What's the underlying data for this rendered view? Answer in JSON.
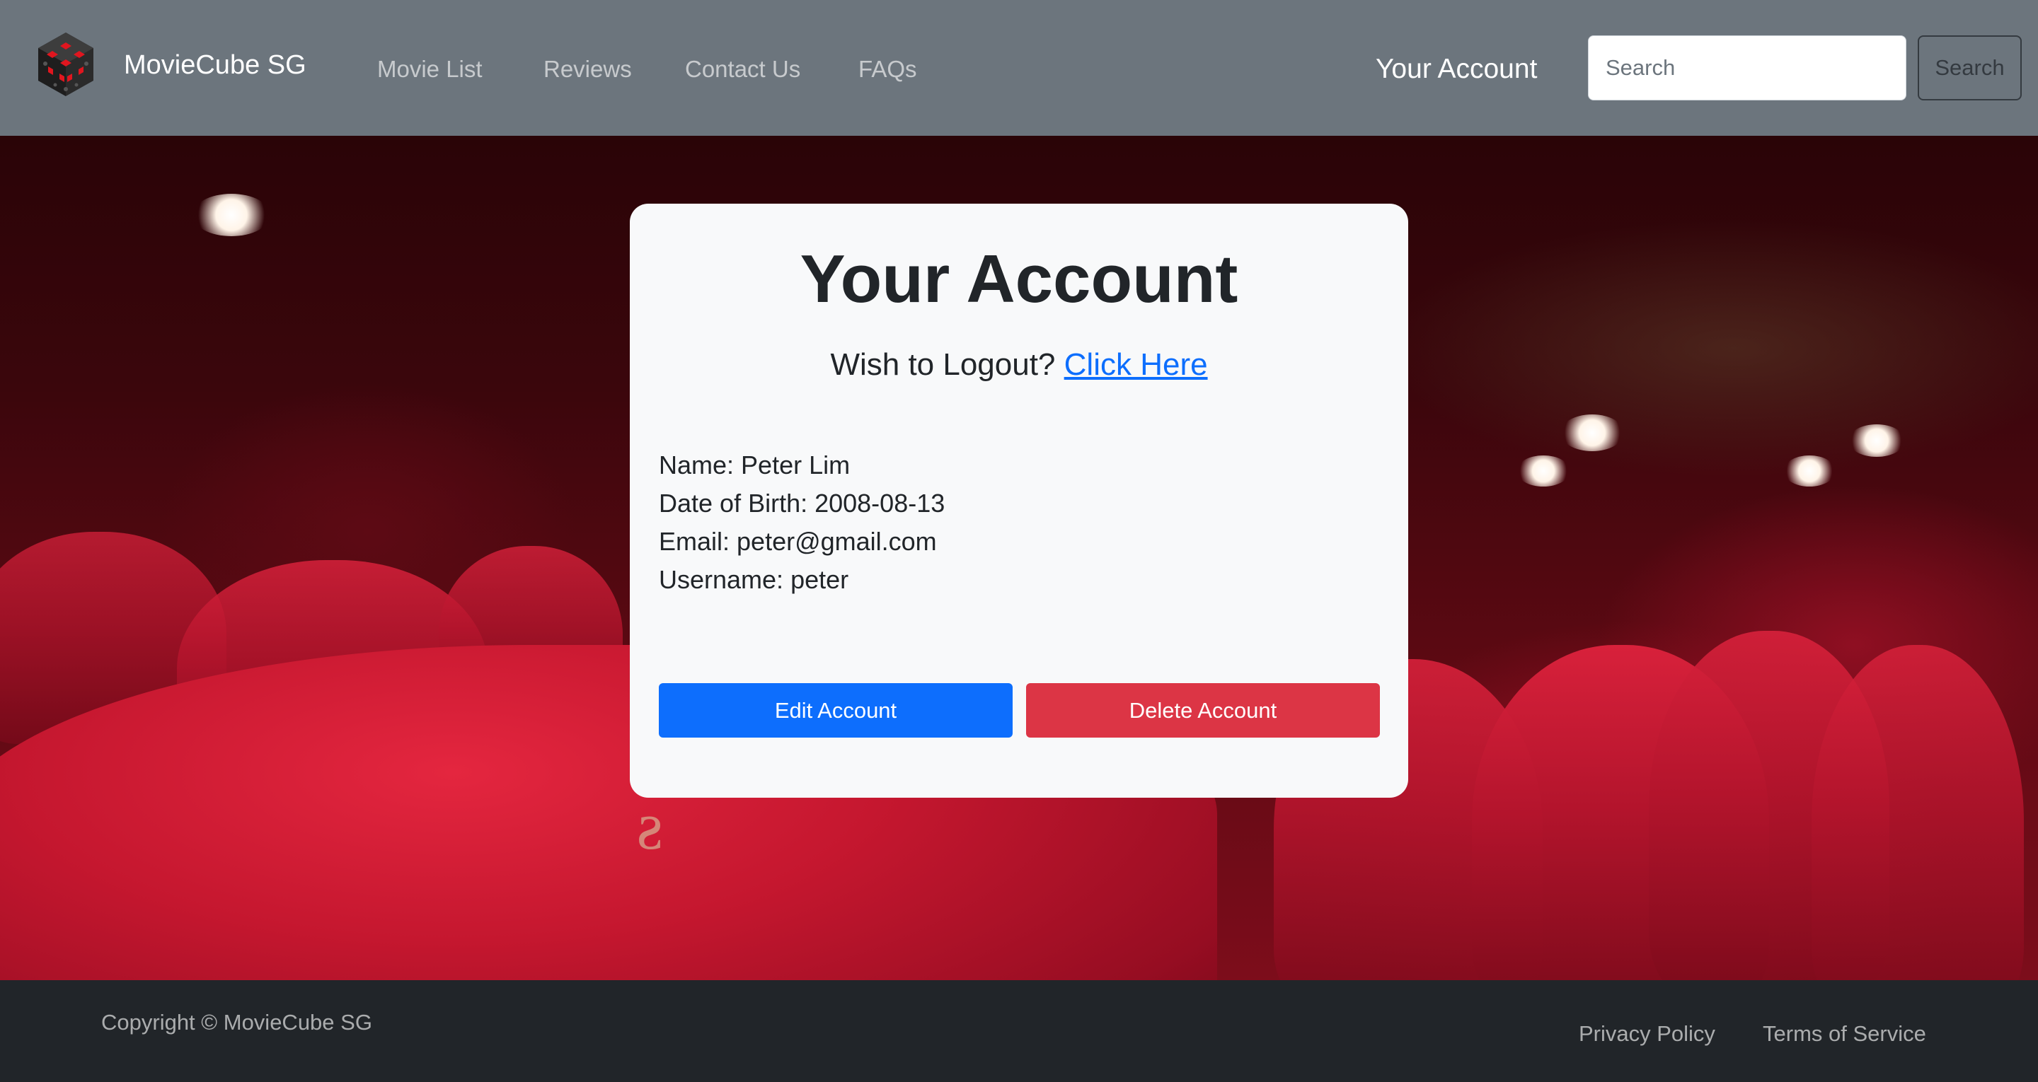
{
  "navbar": {
    "brand_name": "MovieCube SG",
    "links": [
      "Movie List",
      "Reviews",
      "Contact Us",
      "FAQs"
    ],
    "account_label": "Your Account",
    "search": {
      "placeholder": "Search",
      "value": "",
      "button_label": "Search"
    }
  },
  "card": {
    "title": "Your Account",
    "logout_prompt": "Wish to Logout?",
    "logout_link": "Click Here",
    "details": {
      "name": "Name: Peter Lim",
      "dob": "Date of Birth: 2008-08-13",
      "email": "Email: peter@gmail.com",
      "username": "Username: peter"
    },
    "edit_button": "Edit Account",
    "delete_button": "Delete Account"
  },
  "footer": {
    "copyright": "Copyright © MovieCube SG",
    "privacy": "Privacy Policy",
    "terms": "Terms of Service"
  },
  "colors": {
    "navbar_bg": "#6c757d",
    "card_bg": "#f8f9fa",
    "primary": "#0d6efd",
    "danger": "#dc3545",
    "footer_bg": "#212529"
  }
}
